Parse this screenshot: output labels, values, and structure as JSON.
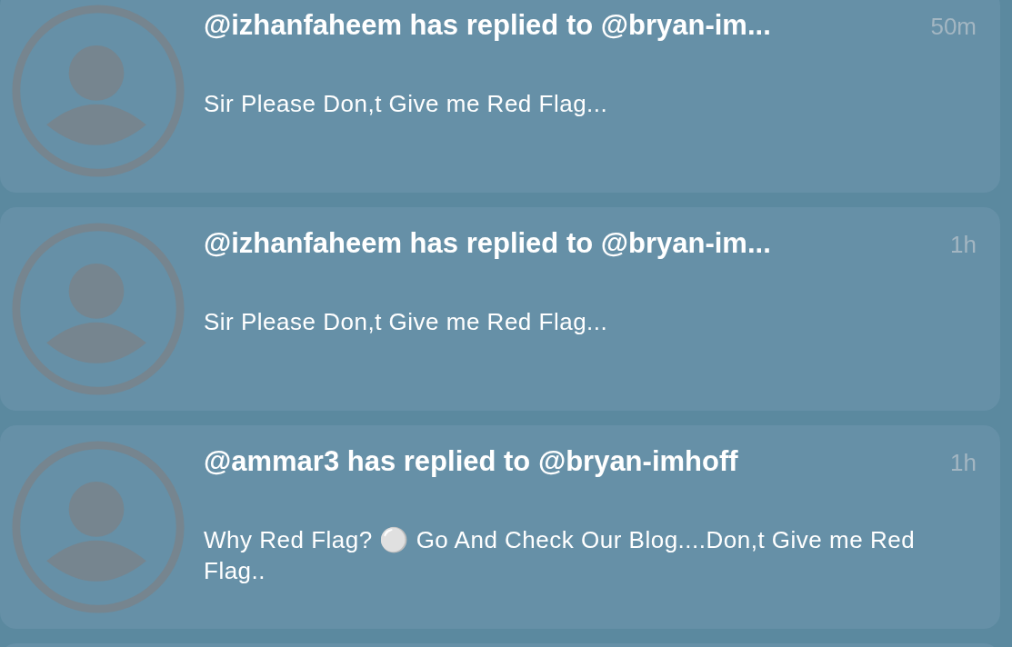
{
  "notifications": [
    {
      "title": "@izhanfaheem has replied to @bryan-im...",
      "time": "50m",
      "message": "Sir Please Don,t Give me Red Flag..."
    },
    {
      "title": "@izhanfaheem has replied to @bryan-im...",
      "time": "1h",
      "message": "Sir Please Don,t Give me Red Flag..."
    },
    {
      "title": "@ammar3 has replied to @bryan-imhoff",
      "time": "1h",
      "message": "Why Red Flag? ⚪ Go And Check Our Blog....Don,t Give me Red Flag.."
    }
  ]
}
